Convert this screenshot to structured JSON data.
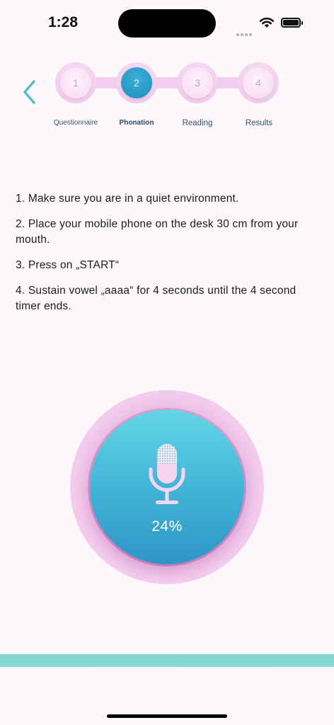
{
  "status_bar": {
    "time": "1:28"
  },
  "stepper": {
    "steps": [
      {
        "number": "1",
        "label": "Questionnaire"
      },
      {
        "number": "2",
        "label": "Phonation"
      },
      {
        "number": "3",
        "label": "Reading"
      },
      {
        "number": "4",
        "label": "Results"
      }
    ],
    "active_step": 2
  },
  "instructions": [
    "1.  Make sure you are in a quiet environment.",
    "2.  Place your mobile phone on the desk 30 cm from your mouth.",
    "3.  Press on „START“",
    "4.  Sustain vowel „aaaa“ for 4 seconds until the 4 second timer ends."
  ],
  "recorder": {
    "progress_text": "24%",
    "progress": 0.24
  },
  "colors": {
    "accent_teal": "#3fb2d5",
    "accent_pink": "#f1c4ea",
    "back_arrow": "#5bbcc7",
    "background": "#fdf8fc"
  },
  "icons": {
    "back": "chevron-left-icon",
    "mic": "microphone-icon",
    "wifi": "wifi-icon",
    "battery": "battery-icon",
    "signal": "cellular-signal-icon"
  }
}
